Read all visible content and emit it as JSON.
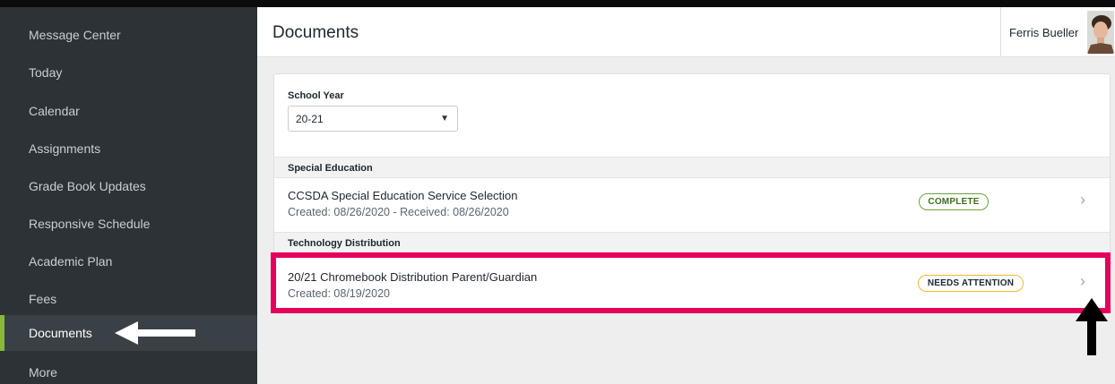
{
  "sidebar": {
    "items": [
      {
        "label": "Message Center"
      },
      {
        "label": "Today"
      },
      {
        "label": "Calendar"
      },
      {
        "label": "Assignments"
      },
      {
        "label": "Grade Book Updates"
      },
      {
        "label": "Responsive Schedule"
      },
      {
        "label": "Academic Plan"
      },
      {
        "label": "Fees"
      },
      {
        "label": "Documents",
        "active": true
      },
      {
        "label": "More"
      }
    ]
  },
  "header": {
    "title": "Documents",
    "user_name": "Ferris Bueller"
  },
  "filters": {
    "school_year_label": "School Year",
    "school_year_value": "20-21"
  },
  "sections": [
    {
      "title": "Special Education",
      "documents": [
        {
          "title": "CCSDA Special Education Service Selection",
          "meta": "Created: 08/26/2020 - Received: 08/26/2020",
          "status": "COMPLETE"
        }
      ]
    },
    {
      "title": "Technology Distribution",
      "documents": [
        {
          "title": "20/21 Chromebook Distribution Parent/Guardian",
          "meta": "Created: 08/19/2020",
          "status": "NEEDS ATTENTION"
        }
      ]
    }
  ],
  "colors": {
    "sidebar_bg": "#2c3236",
    "active_accent": "#86b93c",
    "highlight": "#e4005b",
    "complete_badge": "#6aa33a",
    "attention_badge": "#f2b632"
  }
}
